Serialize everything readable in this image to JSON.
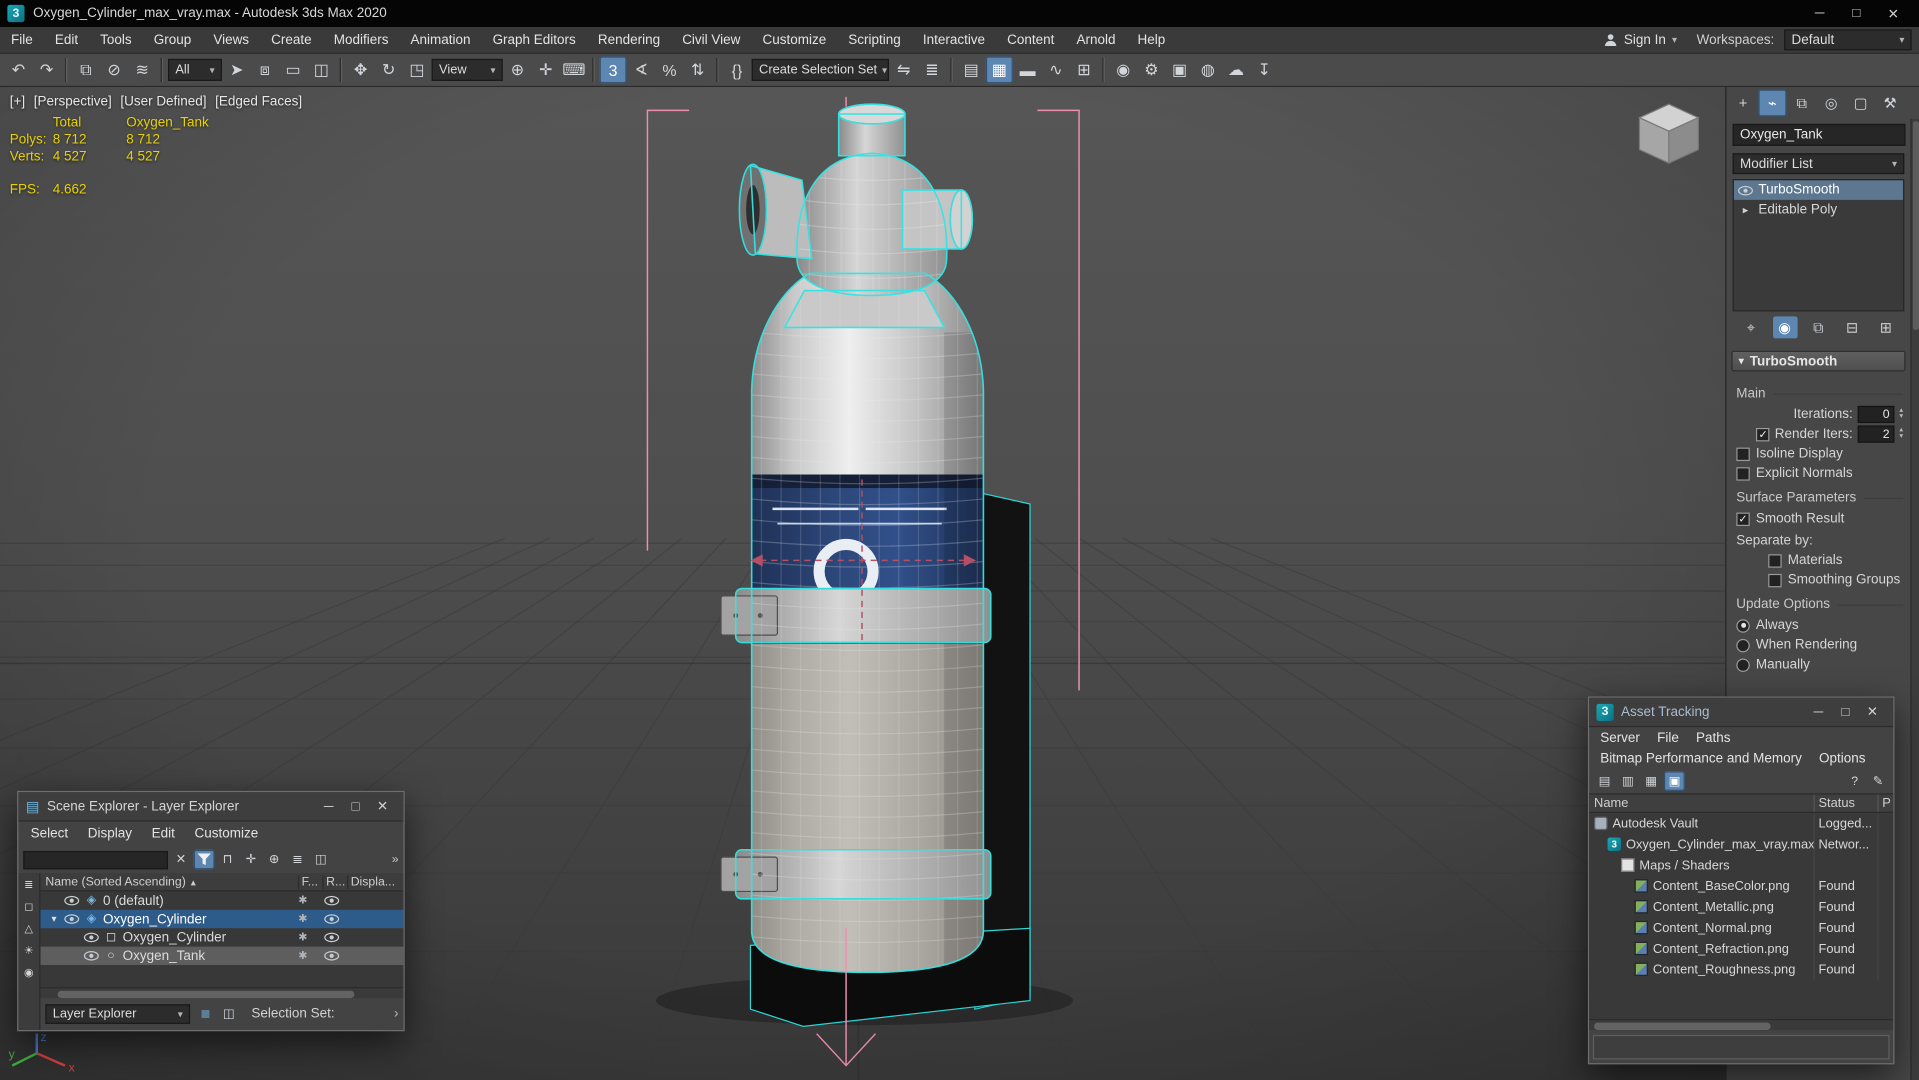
{
  "colors": {
    "selection_outline": "#35e4e4",
    "helper_pink": "#ee8fb0",
    "stats_yellow": "#e8d200",
    "accent_blue": "#5d87b0"
  },
  "window_buttons": {
    "minimize": "─",
    "maximize": "□",
    "close": "✕"
  },
  "title_bar": {
    "icon_letter": "3",
    "title": "Oxygen_Cylinder_max_vray.max - Autodesk 3ds Max 2020"
  },
  "menu_bar": {
    "items": [
      "File",
      "Edit",
      "Tools",
      "Group",
      "Views",
      "Create",
      "Modifiers",
      "Animation",
      "Graph Editors",
      "Rendering",
      "Civil View",
      "Customize",
      "Scripting",
      "Interactive",
      "Content",
      "Arnold",
      "Help"
    ],
    "sign_in": "Sign In",
    "workspaces_label": "Workspaces:",
    "workspaces_value": "Default"
  },
  "toolbar": {
    "items": [
      {
        "t": "icon",
        "name": "undo-icon",
        "glyph": "↶"
      },
      {
        "t": "icon",
        "name": "redo-icon",
        "glyph": "↷"
      },
      {
        "t": "sep"
      },
      {
        "t": "icon",
        "name": "select-and-link-icon",
        "glyph": "⧉"
      },
      {
        "t": "icon",
        "name": "unlink-selection-icon",
        "glyph": "⊘"
      },
      {
        "t": "icon",
        "name": "bind-to-space-warp-icon",
        "glyph": "≋"
      },
      {
        "t": "sep"
      },
      {
        "t": "dropdown",
        "name": "selection-filter-dropdown",
        "label": "All"
      },
      {
        "t": "icon",
        "name": "select-object-icon",
        "glyph": "➤"
      },
      {
        "t": "icon",
        "name": "select-by-name-icon",
        "glyph": "⧈"
      },
      {
        "t": "icon",
        "name": "rectangular-selection-region-icon",
        "glyph": "▭"
      },
      {
        "t": "icon",
        "name": "window-crossing-icon",
        "glyph": "◫"
      },
      {
        "t": "sep"
      },
      {
        "t": "icon",
        "name": "select-and-move-icon",
        "glyph": "✥"
      },
      {
        "t": "icon",
        "name": "select-and-rotate-icon",
        "glyph": "↻"
      },
      {
        "t": "icon",
        "name": "select-and-uniform-scale-icon",
        "glyph": "◳"
      },
      {
        "t": "dropdown",
        "name": "reference-coordinate-dropdown",
        "label": "View"
      },
      {
        "t": "icon",
        "name": "use-pivot-point-center-icon",
        "glyph": "⊕"
      },
      {
        "t": "icon",
        "name": "select-and-manipulate-icon",
        "glyph": "✛"
      },
      {
        "t": "icon",
        "name": "keyboard-shortcut-override-icon",
        "glyph": "⌨"
      },
      {
        "t": "sep"
      },
      {
        "t": "icon",
        "name": "snaps-toggle-3d-icon",
        "glyph": "3",
        "pressed": true
      },
      {
        "t": "icon",
        "name": "angle-snap-icon",
        "glyph": "∢"
      },
      {
        "t": "icon",
        "name": "percent-snap-icon",
        "glyph": "%"
      },
      {
        "t": "icon",
        "name": "spinner-snap-icon",
        "glyph": "⇅"
      },
      {
        "t": "sep"
      },
      {
        "t": "icon",
        "name": "edit-named-selection-sets-icon",
        "glyph": "{}"
      },
      {
        "t": "dropdown",
        "name": "create-selection-set-dropdown",
        "label": "Create Selection Set"
      },
      {
        "t": "icon",
        "name": "mirror-icon",
        "glyph": "⇋"
      },
      {
        "t": "icon",
        "name": "align-icon",
        "glyph": "≣"
      },
      {
        "t": "sep"
      },
      {
        "t": "icon",
        "name": "toggle-scene-explorer-icon",
        "glyph": "▤"
      },
      {
        "t": "icon",
        "name": "toggle-layer-explorer-icon",
        "glyph": "▦",
        "pressed": true
      },
      {
        "t": "icon",
        "name": "toggle-ribbon-icon",
        "glyph": "▬"
      },
      {
        "t": "icon",
        "name": "curve-editor-icon",
        "glyph": "∿"
      },
      {
        "t": "icon",
        "name": "schematic-view-icon",
        "glyph": "⊞"
      },
      {
        "t": "sep"
      },
      {
        "t": "icon",
        "name": "material-editor-icon",
        "glyph": "◉"
      },
      {
        "t": "icon",
        "name": "render-setup-icon",
        "glyph": "⚙"
      },
      {
        "t": "icon",
        "name": "rendered-frame-window-icon",
        "glyph": "▣"
      },
      {
        "t": "icon",
        "name": "render-production-icon",
        "glyph": "◍"
      },
      {
        "t": "icon",
        "name": "render-in-cloud-icon",
        "glyph": "☁"
      },
      {
        "t": "icon",
        "name": "autodesk-app-store-icon",
        "glyph": "↧"
      }
    ]
  },
  "viewport": {
    "label_segments": [
      "[+]",
      "[Perspective]",
      "[User Defined]",
      "[Edged Faces]"
    ],
    "stats": {
      "header": [
        "Total",
        "Oxygen_Tank"
      ],
      "rows": [
        [
          "Polys:",
          "8 712",
          "8 712"
        ],
        [
          "Verts:",
          "4 527",
          "4 527"
        ]
      ],
      "fps_label": "FPS:",
      "fps_value": "4.662"
    },
    "axis_labels": {
      "x": "x",
      "y": "y",
      "z": "z"
    }
  },
  "command_panel": {
    "tabs": [
      {
        "name": "create-tab-icon",
        "glyph": "+"
      },
      {
        "name": "modify-tab-icon",
        "glyph": "⌁",
        "active": true
      },
      {
        "name": "hierarchy-tab-icon",
        "glyph": "⧉"
      },
      {
        "name": "motion-tab-icon",
        "glyph": "◎"
      },
      {
        "name": "display-tab-icon",
        "glyph": "▢"
      },
      {
        "name": "utilities-tab-icon",
        "glyph": "⚒"
      }
    ],
    "object_name": "Oxygen_Tank",
    "modifier_list_label": "Modifier List",
    "stack": [
      {
        "label": "TurboSmooth",
        "selected": true
      },
      {
        "label": "Editable Poly"
      }
    ],
    "stack_buttons": [
      {
        "name": "pin-stack-icon",
        "glyph": "⌖"
      },
      {
        "name": "show-end-result-icon",
        "glyph": "◉",
        "pressed": true
      },
      {
        "name": "make-unique-icon",
        "glyph": "⧉"
      },
      {
        "name": "remove-modifier-icon",
        "glyph": "⊟"
      },
      {
        "name": "configure-modifier-sets-icon",
        "glyph": "⊞"
      }
    ],
    "rollout": {
      "title": "TurboSmooth",
      "items": [
        {
          "type": "section",
          "label": "Main"
        },
        {
          "type": "spinner",
          "label": "Iterations:",
          "value": "0"
        },
        {
          "type": "check-spinner",
          "label": "Render Iters:",
          "value": "2",
          "checked": true
        },
        {
          "type": "check",
          "label": "Isoline Display",
          "checked": false
        },
        {
          "type": "check",
          "label": "Explicit Normals",
          "checked": false
        },
        {
          "type": "section",
          "label": "Surface Parameters"
        },
        {
          "type": "check",
          "label": "Smooth Result",
          "checked": true
        },
        {
          "type": "label",
          "label": "Separate by:"
        },
        {
          "type": "check",
          "label": "Materials",
          "checked": false,
          "indent": true
        },
        {
          "type": "check",
          "label": "Smoothing Groups",
          "checked": false,
          "indent": true
        },
        {
          "type": "section",
          "label": "Update Options"
        },
        {
          "type": "radio",
          "label": "Always",
          "checked": true
        },
        {
          "type": "radio",
          "label": "When Rendering",
          "checked": false
        },
        {
          "type": "radio",
          "label": "Manually",
          "checked": false
        }
      ]
    }
  },
  "scene_explorer": {
    "title": "Scene Explorer - Layer Explorer",
    "icon_glyph": "▤",
    "menus": [
      "Select",
      "Display",
      "Edit",
      "Customize"
    ],
    "toolbar_icons": [
      {
        "name": "clear-search-icon",
        "glyph": "✕"
      },
      {
        "name": "filter-funnel-icon",
        "svg": "funnel",
        "pressed": true
      },
      {
        "name": "lock-selection-icon",
        "glyph": "⊓"
      },
      {
        "name": "pick-select-icon",
        "glyph": "✛"
      },
      {
        "name": "new-layer-icon",
        "glyph": "⊕"
      },
      {
        "name": "nested-layer-mode-icon",
        "glyph": "≣"
      },
      {
        "name": "column-chooser-icon",
        "glyph": "◫"
      }
    ],
    "overflow_chevrons": "»",
    "strip_icons": [
      {
        "name": "display-layers-icon",
        "glyph": "≣"
      },
      {
        "name": "display-geometry-icon",
        "glyph": "◻"
      },
      {
        "name": "display-shapes-icon",
        "glyph": "△"
      },
      {
        "name": "display-lights-icon",
        "glyph": "☀"
      },
      {
        "name": "display-materials-icon",
        "glyph": "◉"
      }
    ],
    "name_column": "Name (Sorted Ascending)",
    "sort_arrow": "▴",
    "columns": [
      "F...",
      "R...",
      "Displa..."
    ],
    "type_glyphs": {
      "layer": "◈",
      "geometry": "◻",
      "object": "○"
    },
    "rows": [
      {
        "label": "0 (default)",
        "indent": 0,
        "icon": "layer"
      },
      {
        "label": "Oxygen_Cylinder",
        "indent": 0,
        "icon": "layer",
        "selected": true,
        "expand": true
      },
      {
        "label": "Oxygen_Cylinder",
        "indent": 1,
        "icon": "geometry"
      },
      {
        "label": "Oxygen_Tank",
        "indent": 1,
        "icon": "object",
        "highlighted": true
      }
    ],
    "footer": {
      "mode_label": "Layer Explorer",
      "icons": [
        {
          "name": "layer-list-icon",
          "glyph": "≣",
          "teal": true
        },
        {
          "name": "grid-view-icon",
          "glyph": "◫"
        }
      ],
      "selection_set_label": "Selection Set:",
      "chevron": "›"
    }
  },
  "asset_tracking": {
    "title": "Asset Tracking",
    "icon_letter": "3",
    "menus_row1": [
      "Server",
      "File",
      "Paths"
    ],
    "menus_row2": [
      "Bitmap Performance and Memory",
      "Options"
    ],
    "toolbar_icons": [
      {
        "name": "asset-table-view-icon",
        "glyph": "▤"
      },
      {
        "name": "asset-list-view-icon",
        "glyph": "▥"
      },
      {
        "name": "asset-thumbnail-view-icon",
        "glyph": "▦"
      },
      {
        "name": "asset-details-view-icon",
        "glyph": "▣",
        "pressed": true
      }
    ],
    "toolbar_icons_right": [
      {
        "name": "asset-help-icon",
        "glyph": "?"
      },
      {
        "name": "asset-edit-icon",
        "glyph": "✎"
      }
    ],
    "columns": [
      "Name",
      "Status",
      "P"
    ],
    "rows": [
      {
        "name": "Autodesk Vault",
        "status": "Logged...",
        "indent": 0,
        "icon": "vault"
      },
      {
        "name": "Oxygen_Cylinder_max_vray.max",
        "status": "Networ...",
        "indent": 1,
        "icon": "max"
      },
      {
        "name": "Maps / Shaders",
        "status": "",
        "indent": 2,
        "icon": "shaders"
      },
      {
        "name": "Content_BaseColor.png",
        "status": "Found",
        "indent": 3,
        "icon": "image"
      },
      {
        "name": "Content_Metallic.png",
        "status": "Found",
        "indent": 3,
        "icon": "image"
      },
      {
        "name": "Content_Normal.png",
        "status": "Found",
        "indent": 3,
        "icon": "image"
      },
      {
        "name": "Content_Refraction.png",
        "status": "Found",
        "indent": 3,
        "icon": "image"
      },
      {
        "name": "Content_Roughness.png",
        "status": "Found",
        "indent": 3,
        "icon": "image"
      }
    ]
  }
}
